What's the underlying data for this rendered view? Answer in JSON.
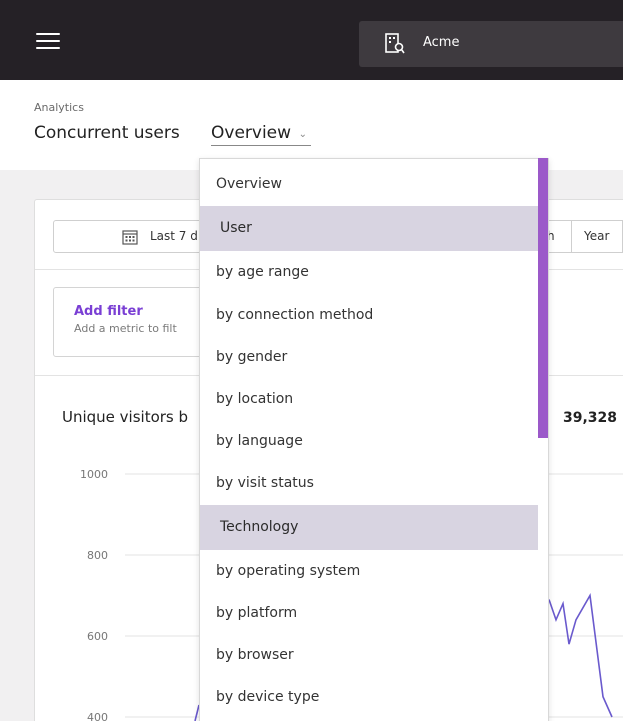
{
  "topbar": {
    "org_name": "Acme",
    "menu_icon": "hamburger-icon",
    "org_icon": "building-search-icon",
    "background": "#252126"
  },
  "header": {
    "breadcrumb": "Analytics",
    "title": "Concurrent users",
    "selected_view": "Overview"
  },
  "toolbar": {
    "date_label": "Last 7 d",
    "segment_partial": "h",
    "year_label": "Year"
  },
  "filter": {
    "title": "Add filter",
    "subtitle": "Add a metric to filt"
  },
  "chart": {
    "title": "Unique visitors b",
    "total": "39,328"
  },
  "chart_data": {
    "type": "line",
    "y_ticks": [
      "1000",
      "800",
      "600",
      "400"
    ],
    "ylim": [
      400,
      1000
    ],
    "series": [
      {
        "values": [
          690,
          640,
          680,
          580,
          640,
          700,
          450,
          400
        ]
      }
    ],
    "color": "#6a5acd"
  },
  "dropdown": {
    "accent": "#9b59c9",
    "items": [
      {
        "type": "option",
        "label": "Overview"
      },
      {
        "type": "group",
        "label": "User"
      },
      {
        "type": "option",
        "label": "by age range"
      },
      {
        "type": "option",
        "label": "by connection method"
      },
      {
        "type": "option",
        "label": "by gender"
      },
      {
        "type": "option",
        "label": "by location"
      },
      {
        "type": "option",
        "label": "by language"
      },
      {
        "type": "option",
        "label": "by visit status"
      },
      {
        "type": "group",
        "label": "Technology"
      },
      {
        "type": "option",
        "label": "by operating system"
      },
      {
        "type": "option",
        "label": "by platform"
      },
      {
        "type": "option",
        "label": "by browser"
      },
      {
        "type": "option",
        "label": "by device type"
      }
    ]
  }
}
